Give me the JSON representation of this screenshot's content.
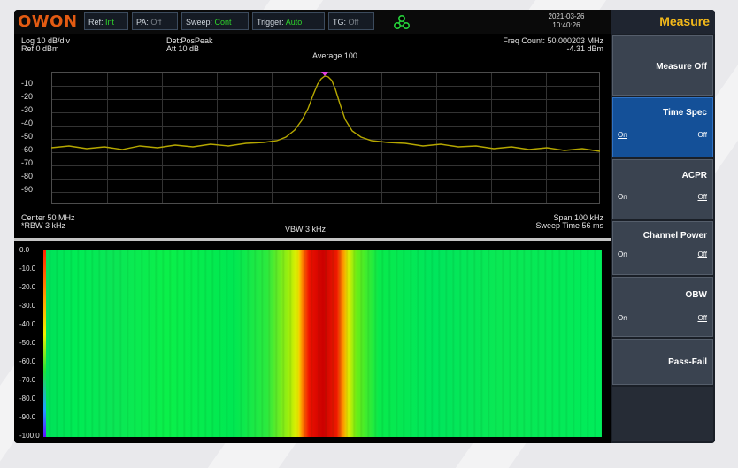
{
  "status": {
    "brand": "OWON",
    "ref": {
      "label": "Ref:",
      "value": "Int"
    },
    "pa": {
      "label": "PA:",
      "value": "Off"
    },
    "sweep": {
      "label": "Sweep:",
      "value": "Cont"
    },
    "trigger": {
      "label": "Trigger:",
      "value": "Auto"
    },
    "tg": {
      "label": "TG:",
      "value": "Off"
    },
    "date": "2021-03-26",
    "time": "10:40:26"
  },
  "spectrum": {
    "scale": "Log 10 dB/div",
    "ref_level": "Ref 0 dBm",
    "detector": "Det:PosPeak",
    "atten": "Att 10 dB",
    "average": "Average 100",
    "freq_count": "Freq Count: 50.000203 MHz",
    "marker_power": "-4.31 dBm",
    "y_ticks": [
      "-10",
      "-20",
      "-30",
      "-40",
      "-50",
      "-60",
      "-70",
      "-80",
      "-90"
    ],
    "center": "Center 50 MHz",
    "rbw": "*RBW 3 kHz",
    "vbw": "VBW 3 kHz",
    "span": "Span 100 kHz",
    "sweep_time": "Sweep Time 56 ms",
    "trace_color": "#b5a700"
  },
  "waterfall": {
    "ticks": [
      "0.0",
      "-10.0",
      "-20.0",
      "-30.0",
      "-40.0",
      "-50.0",
      "-60.0",
      "-70.0",
      "-80.0",
      "-90.0",
      "-100.0"
    ]
  },
  "menu": {
    "title": "Measure",
    "title_color": "#f3b91a",
    "items": [
      {
        "label": "Measure Off"
      },
      {
        "label": "Time Spec",
        "on": "On",
        "off": "Off"
      },
      {
        "label": "ACPR",
        "on": "On",
        "off": "Off"
      },
      {
        "label": "Channel Power",
        "on": "On",
        "off": "Off"
      },
      {
        "label": "OBW",
        "on": "On",
        "off": "Off"
      },
      {
        "label": "Pass-Fail"
      }
    ]
  }
}
